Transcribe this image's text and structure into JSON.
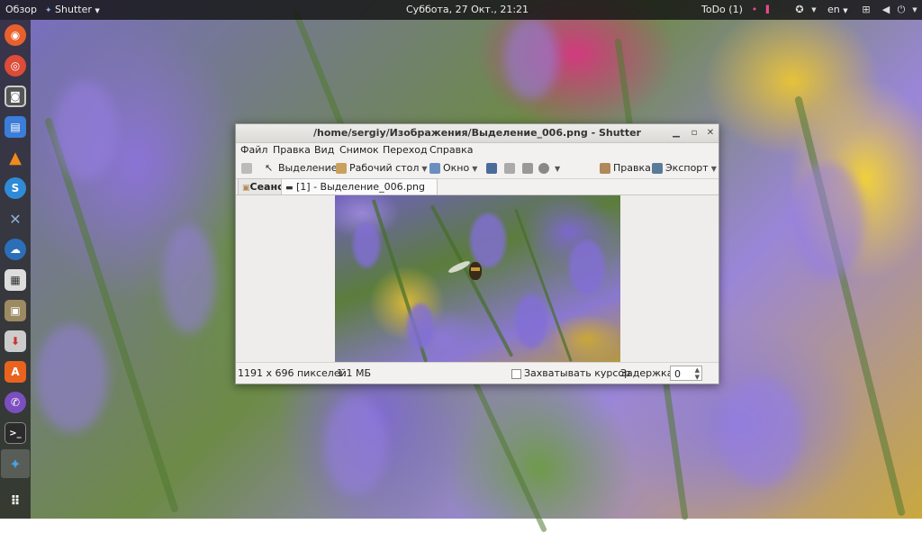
{
  "topbar": {
    "overview": "Обзор",
    "app_menu": "Shutter",
    "clock": "Суббота, 27 Окт., 21:21",
    "todo": "ToDo (1)",
    "language": "en"
  },
  "window": {
    "title": "/home/sergiy/Изображения/Выделение_006.png - Shutter",
    "menu": [
      "Файл",
      "Правка",
      "Вид",
      "Снимок",
      "Переход",
      "Справка"
    ],
    "toolbar": {
      "selection": "Выделение",
      "desktop": "Рабочий стол",
      "window": "Окно",
      "edit": "Правка",
      "export": "Экспорт"
    },
    "tabs": {
      "session": "Сеанс",
      "current": "[1] - Выделение_006.png"
    },
    "status": {
      "image_size": "1191 x 696 пикселей",
      "file_size": "1.1 МБ",
      "capture_cursor": "Захватывать курсор",
      "delay_label": "Задержка:",
      "delay_value": "0"
    }
  }
}
